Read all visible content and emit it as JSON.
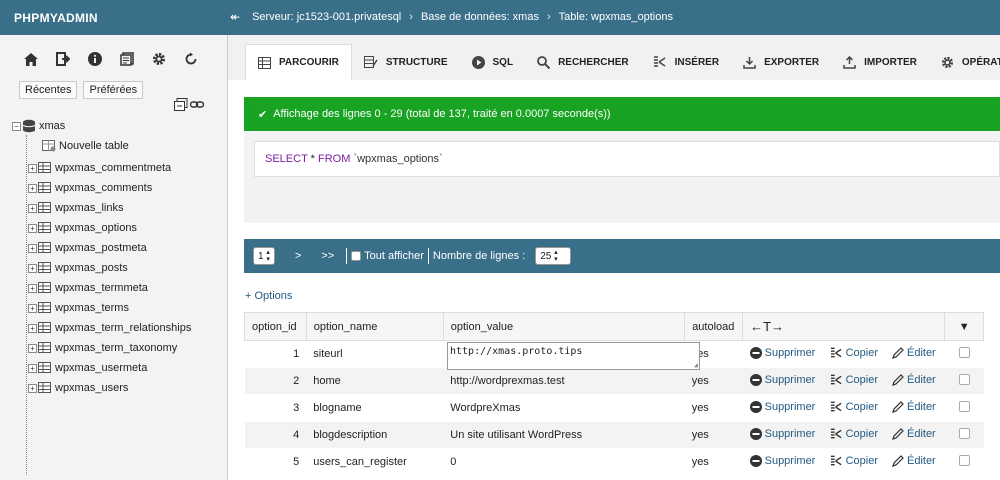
{
  "app": {
    "brand": "PHPMYADMIN"
  },
  "breadcrumb": [
    {
      "label": "Serveur: jc1523-001.privatesql"
    },
    {
      "label": "Base de données: xmas"
    },
    {
      "label": "Table: wpxmas_options"
    }
  ],
  "sidebar": {
    "tabs": [
      "Récentes",
      "Préférées"
    ],
    "db": "xmas",
    "new_table": "Nouvelle table",
    "tables": [
      "wpxmas_commentmeta",
      "wpxmas_comments",
      "wpxmas_links",
      "wpxmas_options",
      "wpxmas_postmeta",
      "wpxmas_posts",
      "wpxmas_termmeta",
      "wpxmas_terms",
      "wpxmas_term_relationships",
      "wpxmas_term_taxonomy",
      "wpxmas_usermeta",
      "wpxmas_users"
    ]
  },
  "tabs": [
    "PARCOURIR",
    "STRUCTURE",
    "SQL",
    "RECHERCHER",
    "INSÉRER",
    "EXPORTER",
    "IMPORTER",
    "OPÉRATIONS"
  ],
  "success": "Affichage des lignes 0 - 29 (total de 137, traité en 0.0007 seconde(s))",
  "sql": {
    "select": "SELECT",
    "star": "*",
    "from": "FROM",
    "table": "`wpxmas_options`"
  },
  "nav": {
    "page": "1",
    "next": ">",
    "last": ">>",
    "hide": "Tout afficher",
    "rows_label": "Nombre de lignes :",
    "rows": "25"
  },
  "options_link": "+ Options",
  "table": {
    "columns": [
      "option_id",
      "option_name",
      "option_value",
      "autoload"
    ],
    "resize_glyph": "←T→",
    "actions": {
      "delete": "Supprimer",
      "copy": "Copier",
      "edit": "Éditer"
    },
    "rows": [
      {
        "id": "1",
        "name": "siteurl",
        "value": "http://xmas.proto.tips",
        "autoload": "yes"
      },
      {
        "id": "2",
        "name": "home",
        "value": "http://wordprexmas.test",
        "autoload": "yes"
      },
      {
        "id": "3",
        "name": "blogname",
        "value": "WordpreXmas",
        "autoload": "yes"
      },
      {
        "id": "4",
        "name": "blogdescription",
        "value": "Un site utilisant WordPress",
        "autoload": "yes"
      },
      {
        "id": "5",
        "name": "users_can_register",
        "value": "0",
        "autoload": "yes"
      }
    ]
  }
}
